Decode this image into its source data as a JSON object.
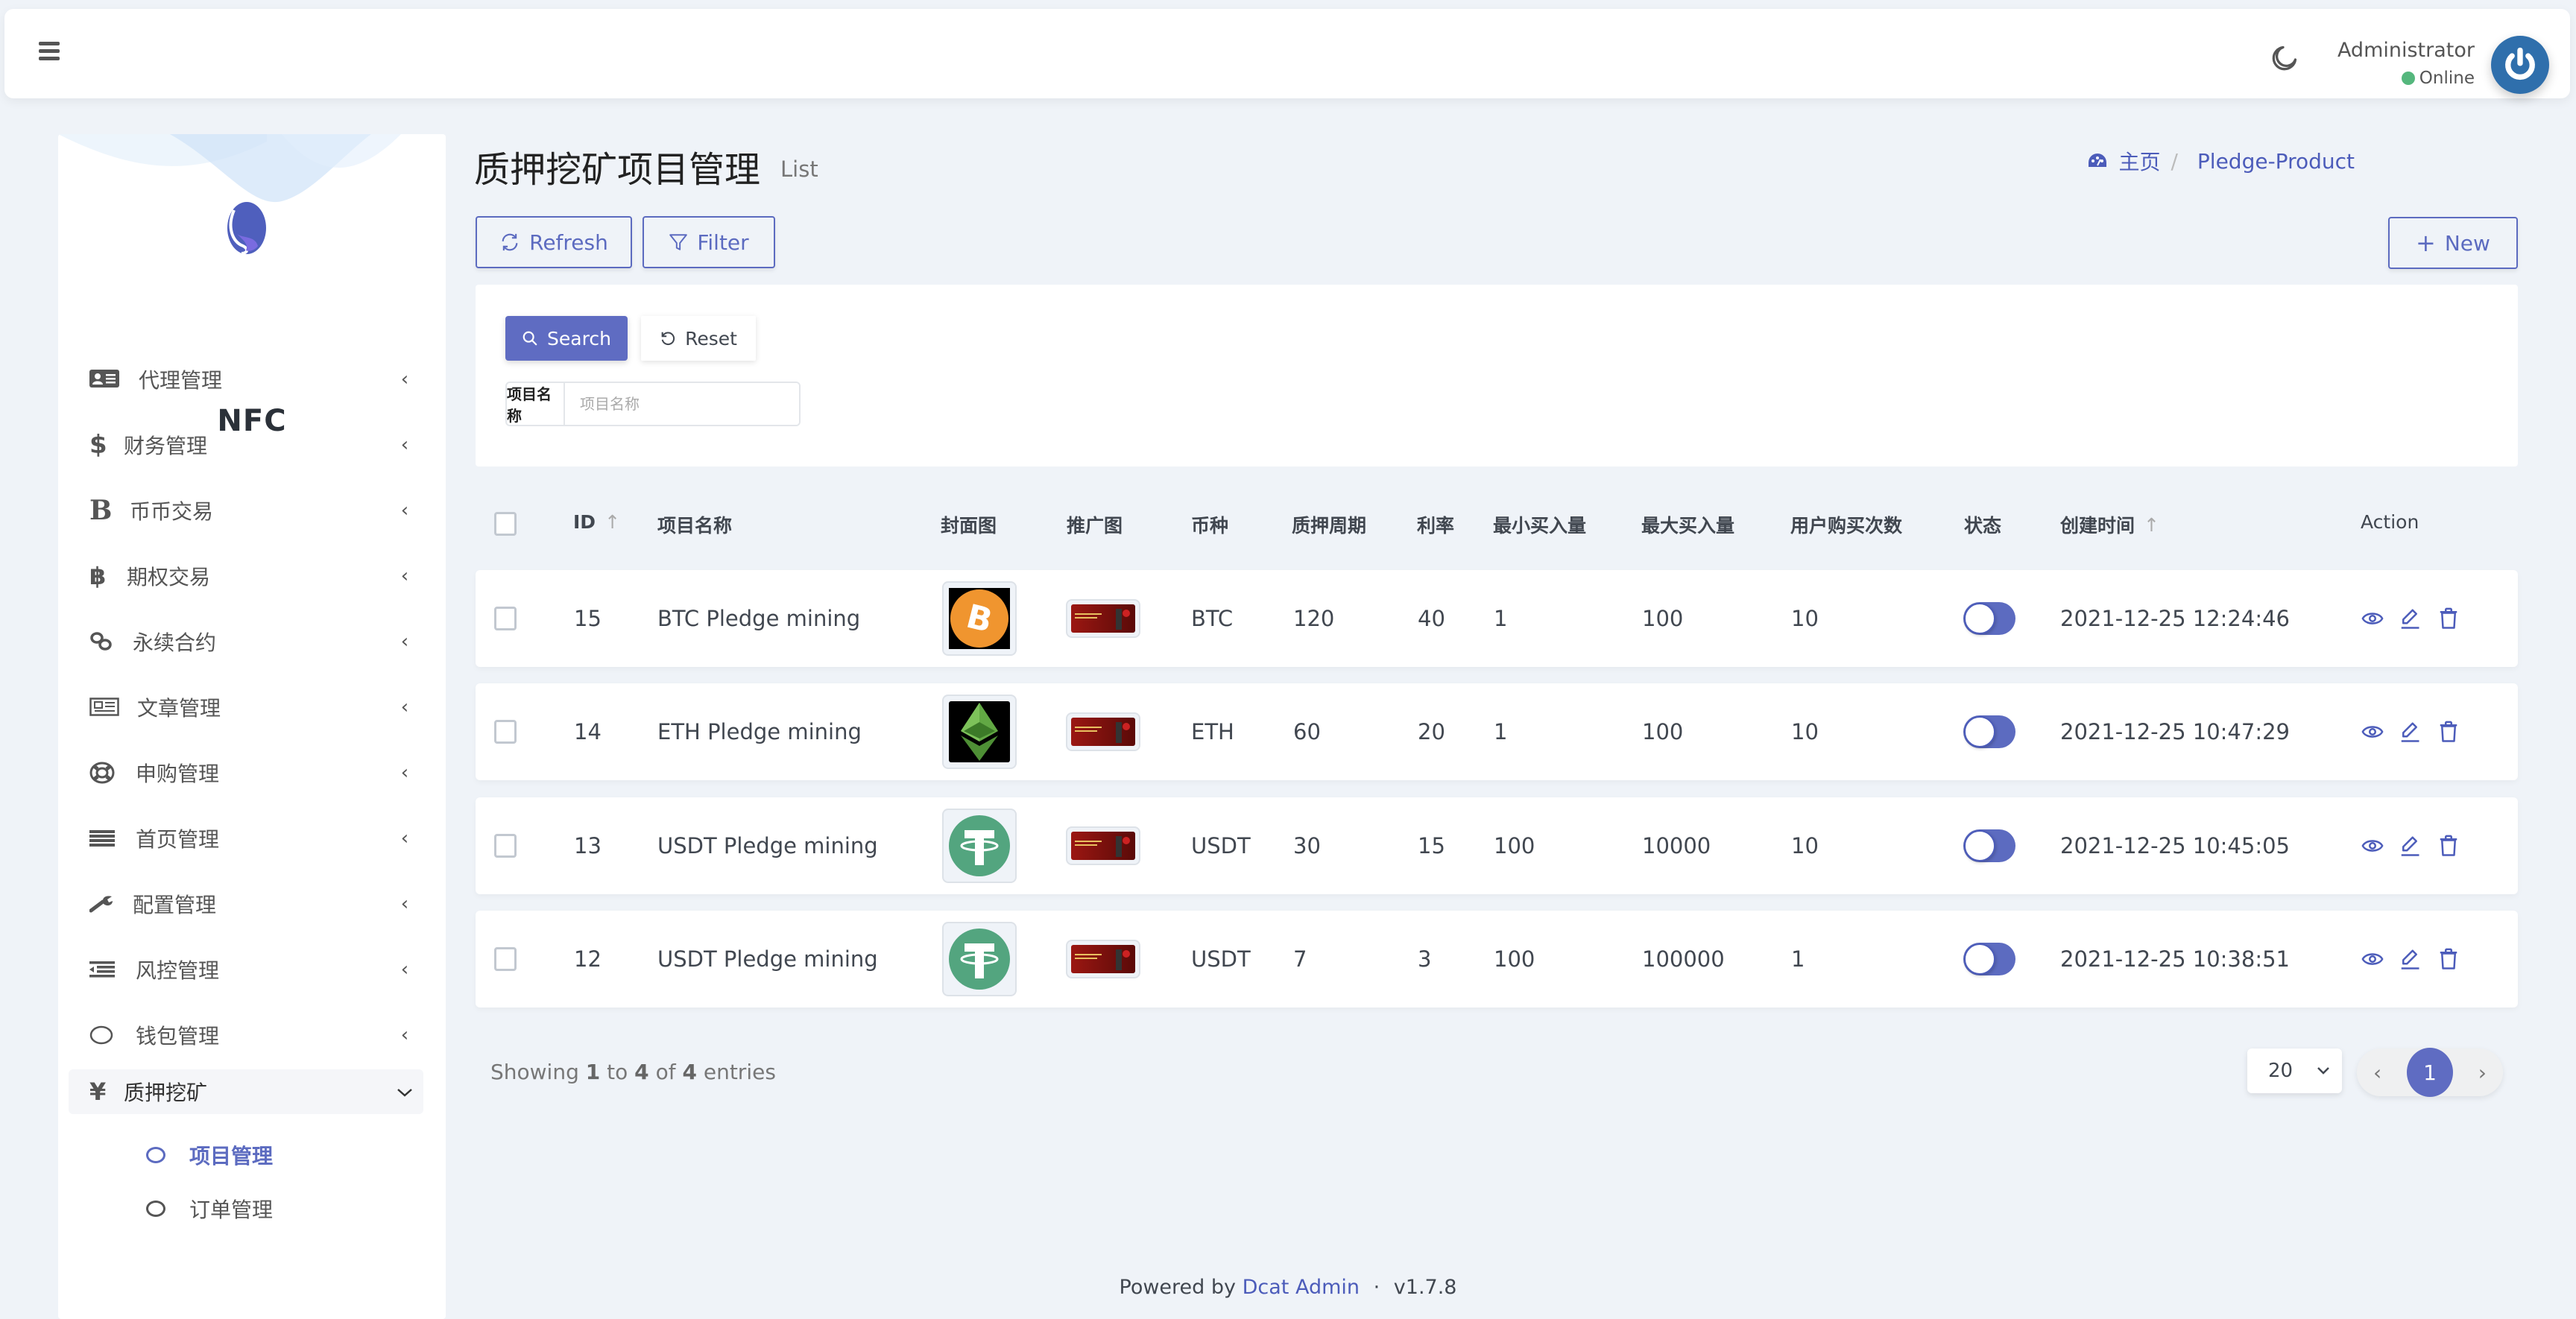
{
  "navbar": {
    "menu_icon": "hamburger-icon",
    "theme_icon": "moon-icon",
    "user_name": "Administrator",
    "user_status": "Online",
    "status_color": "#55b77d",
    "avatar_icon": "power-icon"
  },
  "sidebar": {
    "brand": "NFC",
    "items": [
      {
        "label": "代理管理",
        "icon": "id-card-icon"
      },
      {
        "label": "财务管理",
        "icon": "dollar-icon"
      },
      {
        "label": "币币交易",
        "icon": "b-letter-icon"
      },
      {
        "label": "期权交易",
        "icon": "bitcoin-icon"
      },
      {
        "label": "永续合约",
        "icon": "link-icon"
      },
      {
        "label": "文章管理",
        "icon": "newspaper-icon"
      },
      {
        "label": "申购管理",
        "icon": "life-ring-icon"
      },
      {
        "label": "首页管理",
        "icon": "bars-icon"
      },
      {
        "label": "配置管理",
        "icon": "wrench-icon"
      },
      {
        "label": "风控管理",
        "icon": "outdent-icon"
      },
      {
        "label": "钱包管理",
        "icon": "circle-icon"
      },
      {
        "label": "质押挖矿",
        "icon": "yen-icon",
        "open": true
      }
    ],
    "sub_items": [
      {
        "label": "项目管理",
        "active": true
      },
      {
        "label": "订单管理",
        "active": false
      }
    ]
  },
  "header": {
    "title": "质押挖矿项目管理",
    "subtitle": "List",
    "breadcrumb": [
      {
        "label": "主页",
        "icon": "dashboard-icon"
      },
      {
        "label": "Pledge-Product"
      }
    ]
  },
  "toolbar": {
    "refresh_label": "Refresh",
    "filter_label": "Filter",
    "new_label": "New"
  },
  "filter": {
    "search_label": "Search",
    "reset_label": "Reset",
    "field_label": "项目名称",
    "field_placeholder": "项目名称",
    "field_value": ""
  },
  "table": {
    "columns": [
      "ID",
      "项目名称",
      "封面图",
      "推广图",
      "币种",
      "质押周期",
      "利率",
      "最小买入量",
      "最大买入量",
      "用户购买次数",
      "状态",
      "创建时间",
      "Action"
    ],
    "rows": [
      {
        "id": "15",
        "name": "BTC Pledge mining",
        "cover": "btc",
        "currency": "BTC",
        "period": "120",
        "rate": "40",
        "min": "1",
        "max": "100",
        "times": "10",
        "status": true,
        "created": "2021-12-25 12:24:46"
      },
      {
        "id": "14",
        "name": "ETH Pledge mining",
        "cover": "eth",
        "currency": "ETH",
        "period": "60",
        "rate": "20",
        "min": "1",
        "max": "100",
        "times": "10",
        "status": true,
        "created": "2021-12-25 10:47:29"
      },
      {
        "id": "13",
        "name": "USDT Pledge mining",
        "cover": "usdt",
        "currency": "USDT",
        "period": "30",
        "rate": "15",
        "min": "100",
        "max": "10000",
        "times": "10",
        "status": true,
        "created": "2021-12-25 10:45:05"
      },
      {
        "id": "12",
        "name": "USDT Pledge mining",
        "cover": "usdt",
        "currency": "USDT",
        "period": "7",
        "rate": "3",
        "min": "100",
        "max": "100000",
        "times": "1",
        "status": true,
        "created": "2021-12-25 10:38:51"
      }
    ]
  },
  "pagination": {
    "showing_prefix": "Showing",
    "from": "1",
    "to_word": "to",
    "to": "4",
    "of_word": "of",
    "total": "4",
    "suffix": "entries",
    "per_page": "20",
    "current_page": "1"
  },
  "footer": {
    "powered_by": "Powered by",
    "link_text": "Dcat Admin",
    "separator": "·",
    "version": "v1.7.8"
  },
  "colors": {
    "primary": "#5c6bc0",
    "background": "#eff3f8",
    "online": "#55b77d",
    "btc": "#f0952f",
    "usdt": "#53a57f",
    "eth": "#62a844"
  }
}
